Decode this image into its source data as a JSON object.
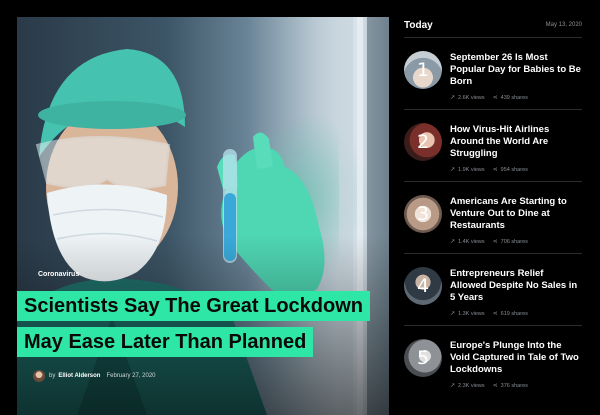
{
  "hero": {
    "category": "Coronavirus",
    "headline_line1": "Scientists Say The Great Lockdown",
    "headline_line2": "May Ease Later Than Planned",
    "by": "by",
    "author": "Elliot Alderson",
    "date": "February 27, 2020",
    "accent_color": "#2ee6a6"
  },
  "sidebar": {
    "title": "Today",
    "date": "May 13, 2020",
    "items": [
      {
        "number": "1",
        "title": "September 26 Is Most Popular Day for Babies to Be Born",
        "views": "2.6K views",
        "shares": "439 shares"
      },
      {
        "number": "2",
        "title": "How Virus-Hit Airlines Around the World Are Struggling",
        "views": "1.9K views",
        "shares": "954 shares"
      },
      {
        "number": "3",
        "title": "Americans Are Starting to Venture Out to Dine at Restaurants",
        "views": "1.4K views",
        "shares": "706 shares"
      },
      {
        "number": "4",
        "title": "Entrepreneurs Relief Allowed Despite No Sales in 5 Years",
        "views": "1.3K views",
        "shares": "619 shares"
      },
      {
        "number": "5",
        "title": "Europe's Plunge Into the Void Captured in Tale of Two Lockdowns",
        "views": "2.3K views",
        "shares": "376 shares"
      }
    ]
  }
}
